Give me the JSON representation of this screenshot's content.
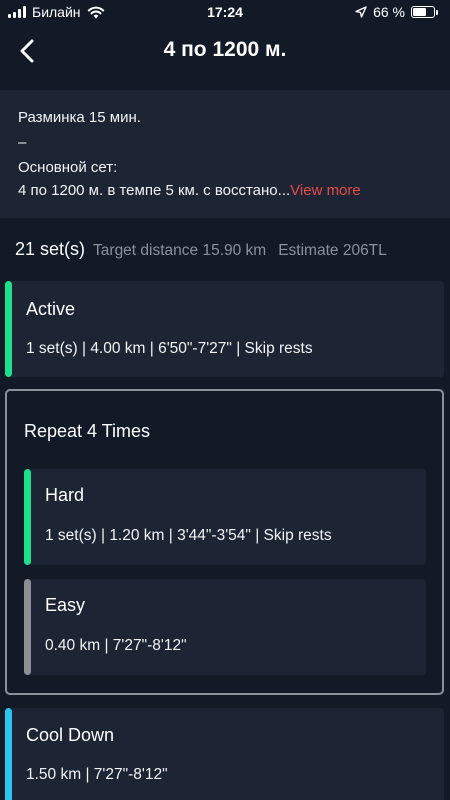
{
  "status_bar": {
    "carrier": "Билайн",
    "time": "17:24",
    "battery_text": "66 %",
    "battery_level": 0.66,
    "icons": [
      "signal-icon",
      "wifi-icon",
      "location-arrow-icon",
      "battery-icon"
    ]
  },
  "nav": {
    "title": "4 по 1200 м.",
    "back_icon": "chevron-left-icon"
  },
  "description": {
    "line1": "Разминка 15 мин.",
    "line2": "–",
    "line3": "Основной сет:",
    "line4": "4 по 1200 м. в темпе 5 км. с восстано...",
    "view_more": "View more"
  },
  "summary": {
    "sets": "21 set(s)",
    "target_distance": "Target distance 15.90 km",
    "estimate": "Estimate 206TL"
  },
  "colors": {
    "active": "#1de08b",
    "hard": "#1de08b",
    "easy": "#8e8f93",
    "cooldown": "#2cc2f2",
    "link": "#e84a47"
  },
  "steps": {
    "active": {
      "title": "Active",
      "detail": "1 set(s) | 4.00 km | 6'50\"-7'27\" | Skip rests"
    },
    "repeat": {
      "title": "Repeat 4 Times",
      "hard": {
        "title": "Hard",
        "detail": "1 set(s) | 1.20 km | 3'44\"-3'54\" | Skip rests"
      },
      "easy": {
        "title": "Easy",
        "detail": "0.40 km | 7'27\"-8'12\""
      }
    },
    "cooldown": {
      "title": "Cool Down",
      "detail": "1.50 km | 7'27\"-8'12\""
    }
  }
}
